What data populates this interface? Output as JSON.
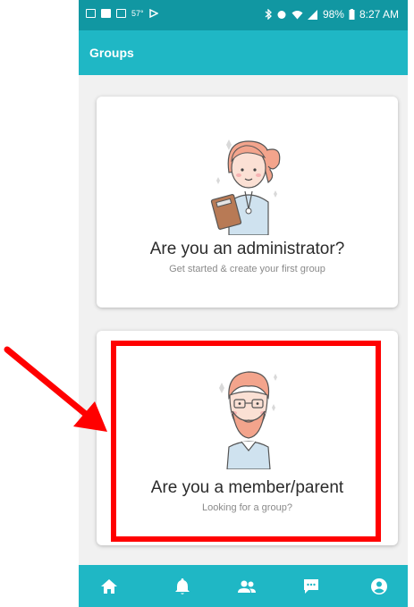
{
  "status_bar": {
    "left_text": "57°",
    "battery": "98%",
    "time": "8:27 AM"
  },
  "app_bar": {
    "title": "Groups"
  },
  "cards": [
    {
      "heading": "Are you an administrator?",
      "subtext": "Get started & create your first group",
      "icon": "administrator-illustration"
    },
    {
      "heading": "Are you a member/parent",
      "subtext": "Looking for a group?",
      "icon": "member-illustration"
    }
  ],
  "bottom_nav": [
    {
      "icon": "home-icon"
    },
    {
      "icon": "bell-icon"
    },
    {
      "icon": "groups-icon"
    },
    {
      "icon": "chat-icon"
    },
    {
      "icon": "account-icon"
    }
  ],
  "colors": {
    "status_bar": "#1197a2",
    "app_bar": "#1fb7c5",
    "annotation": "#ff0000"
  }
}
